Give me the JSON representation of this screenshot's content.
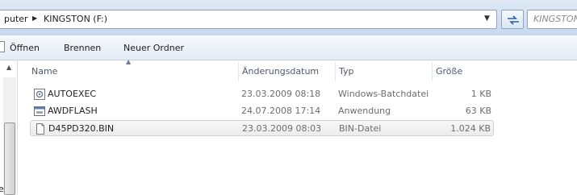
{
  "address": {
    "previous_crumb": "puter",
    "current_crumb": "KINGSTON (F:)",
    "search_placeholder": "KINGSTON"
  },
  "toolbar": {
    "open_label": "Öffnen",
    "burn_label": "Brennen",
    "new_folder_label": "Neuer Ordner"
  },
  "nav": {
    "partial_label": "e"
  },
  "columns": {
    "name": "Name",
    "modified": "Änderungsdatum",
    "type": "Typ",
    "size": "Größe"
  },
  "files": [
    {
      "name": "AUTOEXEC",
      "modified": "23.03.2009 08:18",
      "type": "Windows-Batchdatei",
      "size": "1 KB",
      "icon": "batch-file-icon"
    },
    {
      "name": "AWDFLASH",
      "modified": "24.07.2008 17:14",
      "type": "Anwendung",
      "size": "63 KB",
      "icon": "application-icon"
    },
    {
      "name": "D45PD320.BIN",
      "modified": "23.03.2009 08:03",
      "type": "BIN-Datei",
      "size": "1.024 KB",
      "icon": "generic-file-icon",
      "selected": true
    }
  ]
}
